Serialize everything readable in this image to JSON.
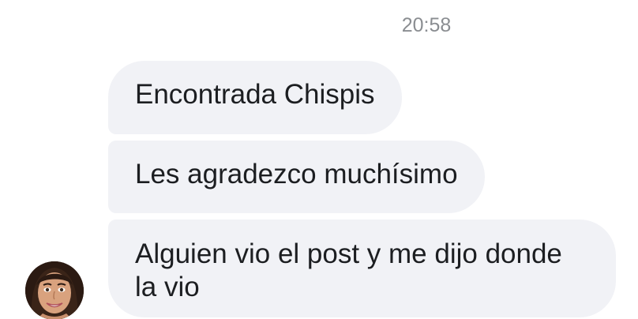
{
  "conversation": {
    "timestamp": "20:58",
    "messages": [
      {
        "text": "Encontrada Chispis"
      },
      {
        "text": "Les agradezco muchísimo"
      },
      {
        "text": "Alguien vio el post y me dijo donde la vio"
      }
    ],
    "sender": {
      "avatar_icon": "user-avatar-photo"
    }
  },
  "colors": {
    "bubble_background": "#f1f2f6",
    "message_text": "#1c1e21",
    "timestamp_text": "#8a8d91",
    "page_background": "#ffffff"
  }
}
